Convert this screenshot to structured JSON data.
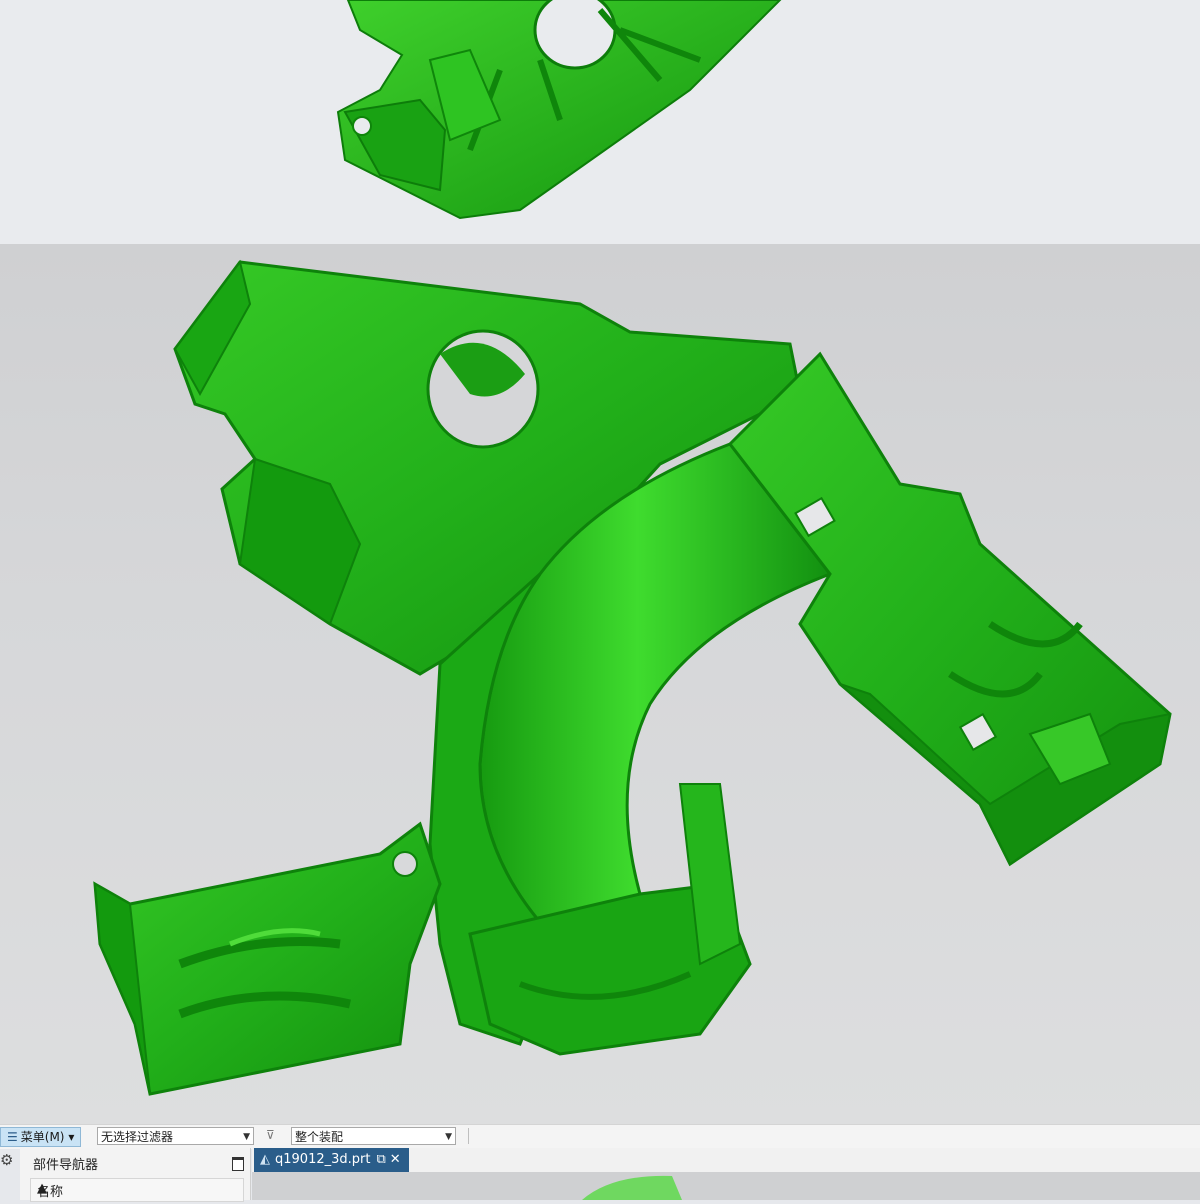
{
  "toolbar": {
    "menu_label": "菜单(M)",
    "menu_arrow": "▾",
    "selection_filter": "无选择过滤器",
    "assembly_scope": "整个装配",
    "filter_icon": "funnel-icon"
  },
  "part_navigator": {
    "title": "部件导航器",
    "column_name": "名称",
    "sort_glyph": "▲"
  },
  "document_tab": {
    "filename": "q19012_3d.prt",
    "close_glyph": "✕"
  },
  "colors": {
    "model_green": "#22b01a",
    "model_dark": "#118a0e",
    "model_light": "#4fdc3a",
    "background": "#d3d4d6",
    "tab_active": "#2a5d8a"
  }
}
